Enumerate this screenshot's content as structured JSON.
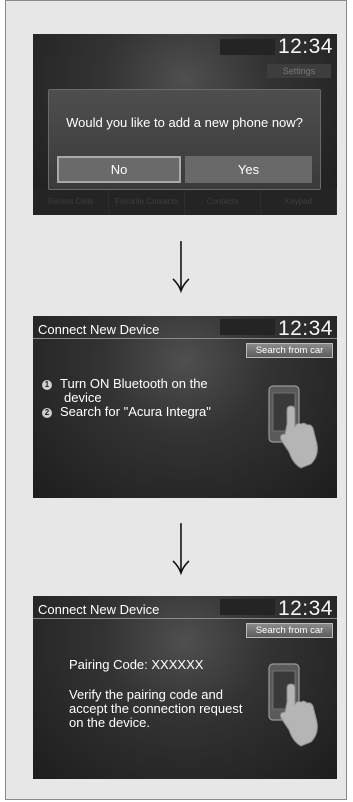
{
  "screen1": {
    "clock": "12:34",
    "settings_label": "Settings",
    "dialog_text": "Would you like to add a new phone now?",
    "no_label": "No",
    "yes_label": "Yes",
    "bottom_items": [
      "Recent Calls",
      "Favorite Contacts",
      "Contacts",
      "Keypad"
    ]
  },
  "screen2": {
    "title": "Connect New Device",
    "clock": "12:34",
    "search_button": "Search from car",
    "step1_number": "1",
    "step1_line1": "Turn ON Bluetooth on the",
    "step1_line2": "device",
    "step2_number": "2",
    "step2_text": "Search for \"Acura Integra\""
  },
  "screen3": {
    "title": "Connect New Device",
    "clock": "12:34",
    "search_button": "Search from car",
    "pairing_code": "Pairing Code: XXXXXX",
    "line1": "Verify the pairing code and",
    "line2": "accept the connection request",
    "line3": "on the device."
  },
  "icons": [
    "down-arrow-icon",
    "phone-touch-icon"
  ]
}
